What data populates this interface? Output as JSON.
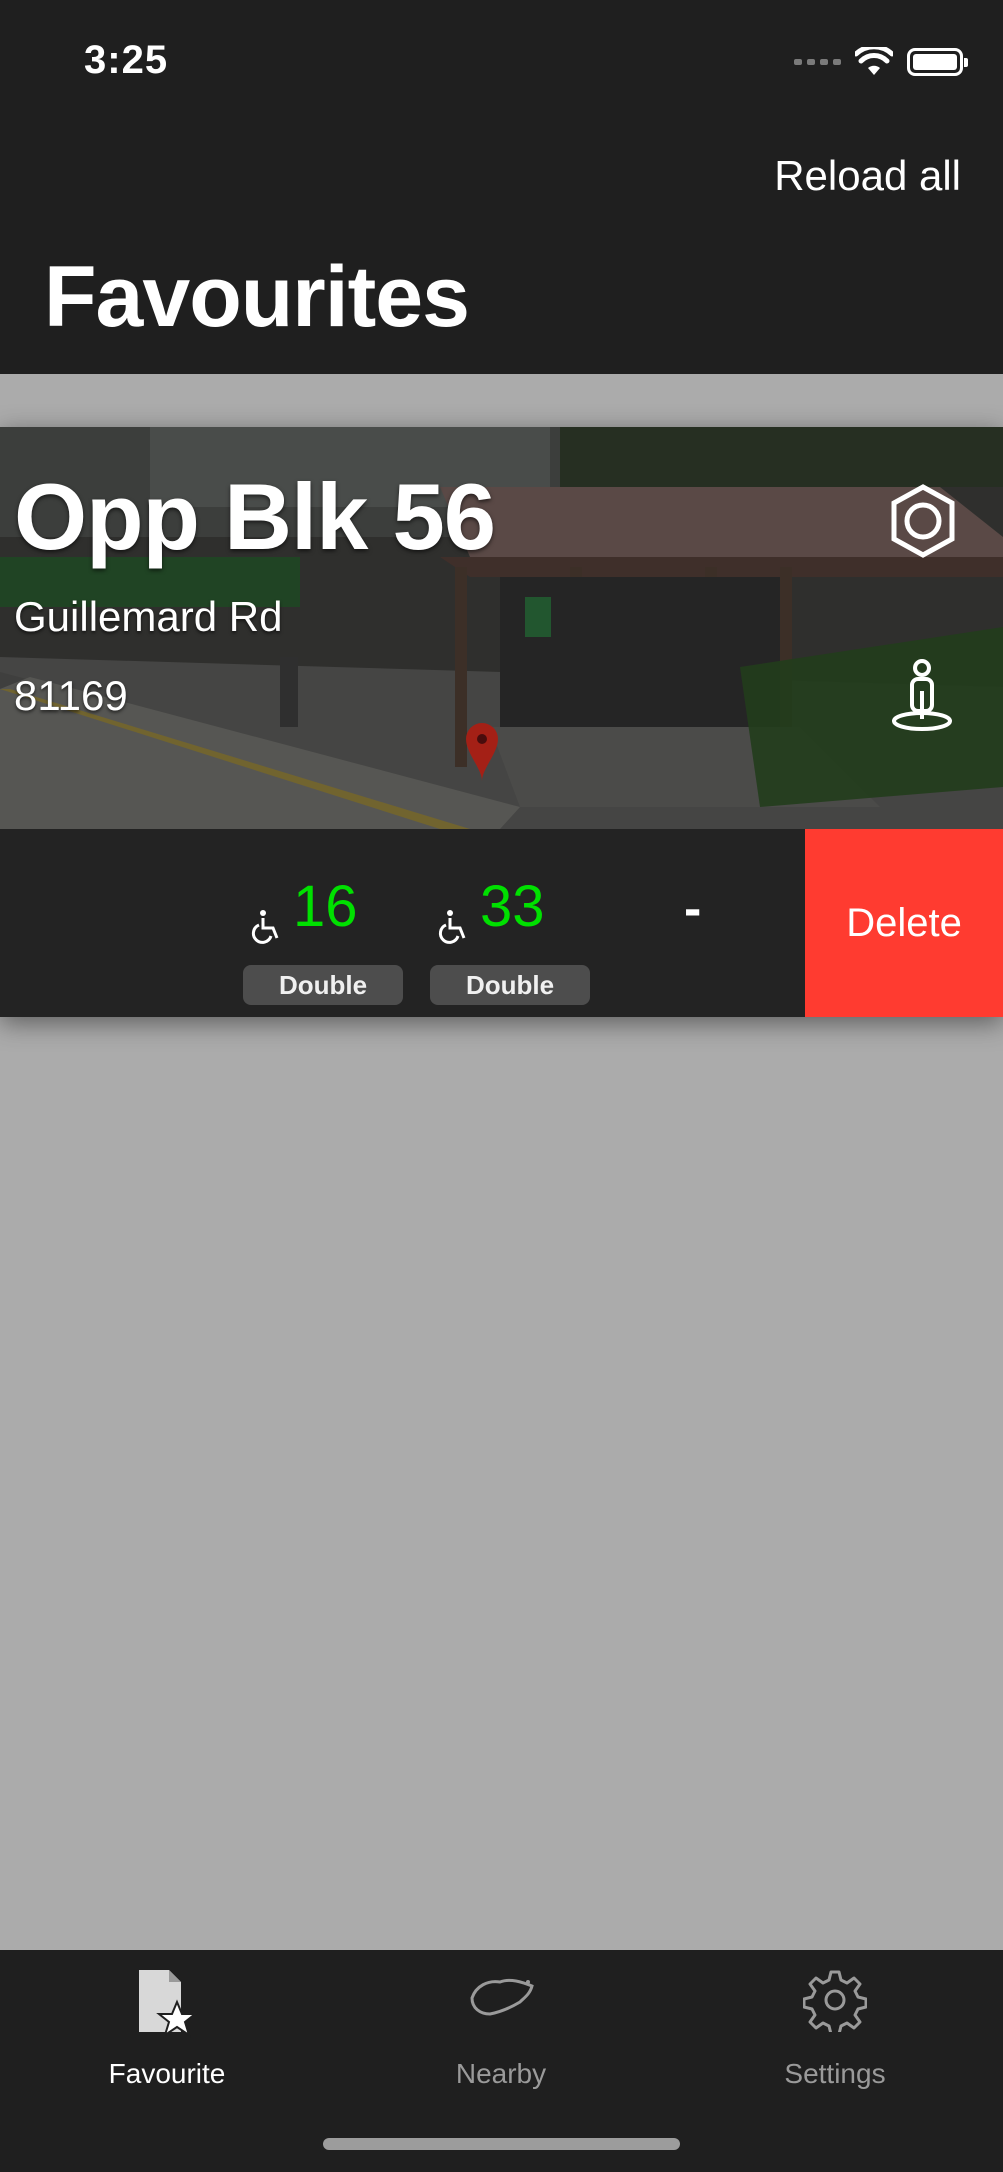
{
  "status_bar": {
    "time": "3:25"
  },
  "header": {
    "reload_label": "Reload all",
    "title": "Favourites"
  },
  "favourite_card": {
    "stop_name": "Opp Blk 56",
    "road_name": "Guillemard Rd",
    "stop_code": "81169",
    "buses": [
      {
        "number": "16",
        "deck": "Double",
        "wheelchair_icon": "wheelchair-icon",
        "status_color": "#00e000"
      },
      {
        "number": "33",
        "deck": "Double",
        "wheelchair_icon": "wheelchair-icon",
        "status_color": "#00e000"
      }
    ],
    "next_placeholder": "-",
    "delete_label": "Delete",
    "delete_color": "#ff3b30"
  },
  "tabbar": {
    "tabs": [
      {
        "label": "Favourite",
        "icon": "favourite-doc-star-icon",
        "active": true
      },
      {
        "label": "Nearby",
        "icon": "singapore-map-icon",
        "active": false
      },
      {
        "label": "Settings",
        "icon": "gear-icon",
        "active": false
      }
    ]
  }
}
